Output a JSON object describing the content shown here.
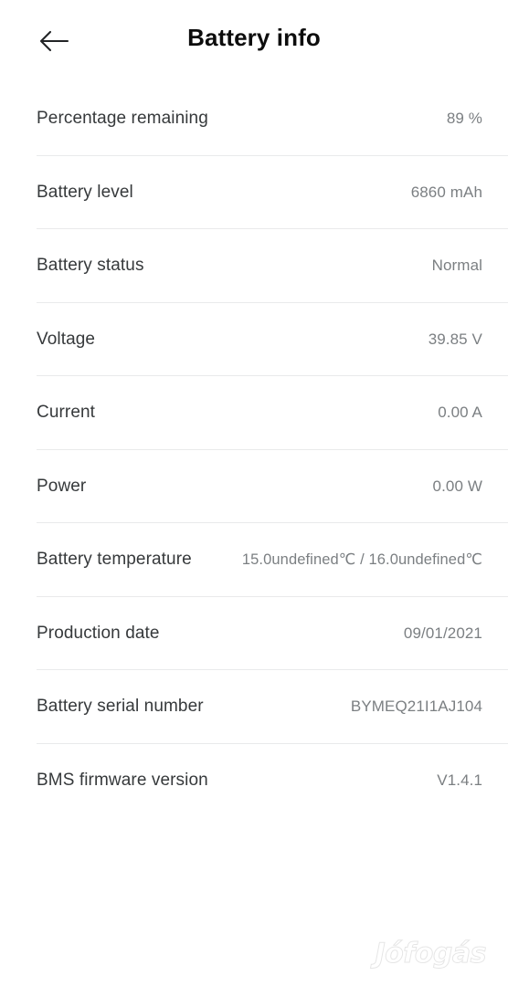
{
  "appbar": {
    "back_icon": "arrow-left-icon",
    "title": "Battery info"
  },
  "rows": [
    {
      "label": "Percentage remaining",
      "value": "89 %"
    },
    {
      "label": "Battery level",
      "value": "6860 mAh"
    },
    {
      "label": "Battery status",
      "value": "Normal"
    },
    {
      "label": "Voltage",
      "value": "39.85 V"
    },
    {
      "label": "Current",
      "value": "0.00 A"
    },
    {
      "label": "Power",
      "value": "0.00 W"
    },
    {
      "label": "Battery temperature",
      "value": "15.0undefined℃ / 16.0undefined℃"
    },
    {
      "label": "Production date",
      "value": "09/01/2021"
    },
    {
      "label": "Battery serial number",
      "value": "BYMEQ21I1AJ104"
    },
    {
      "label": "BMS firmware version",
      "value": "V1.4.1"
    }
  ],
  "watermark": {
    "text": "Jófogás"
  },
  "colors": {
    "background": "#ffffff",
    "title": "#0d0d0d",
    "label": "#36393b",
    "value": "#7b7f82",
    "separator": "#e9eaeb"
  }
}
